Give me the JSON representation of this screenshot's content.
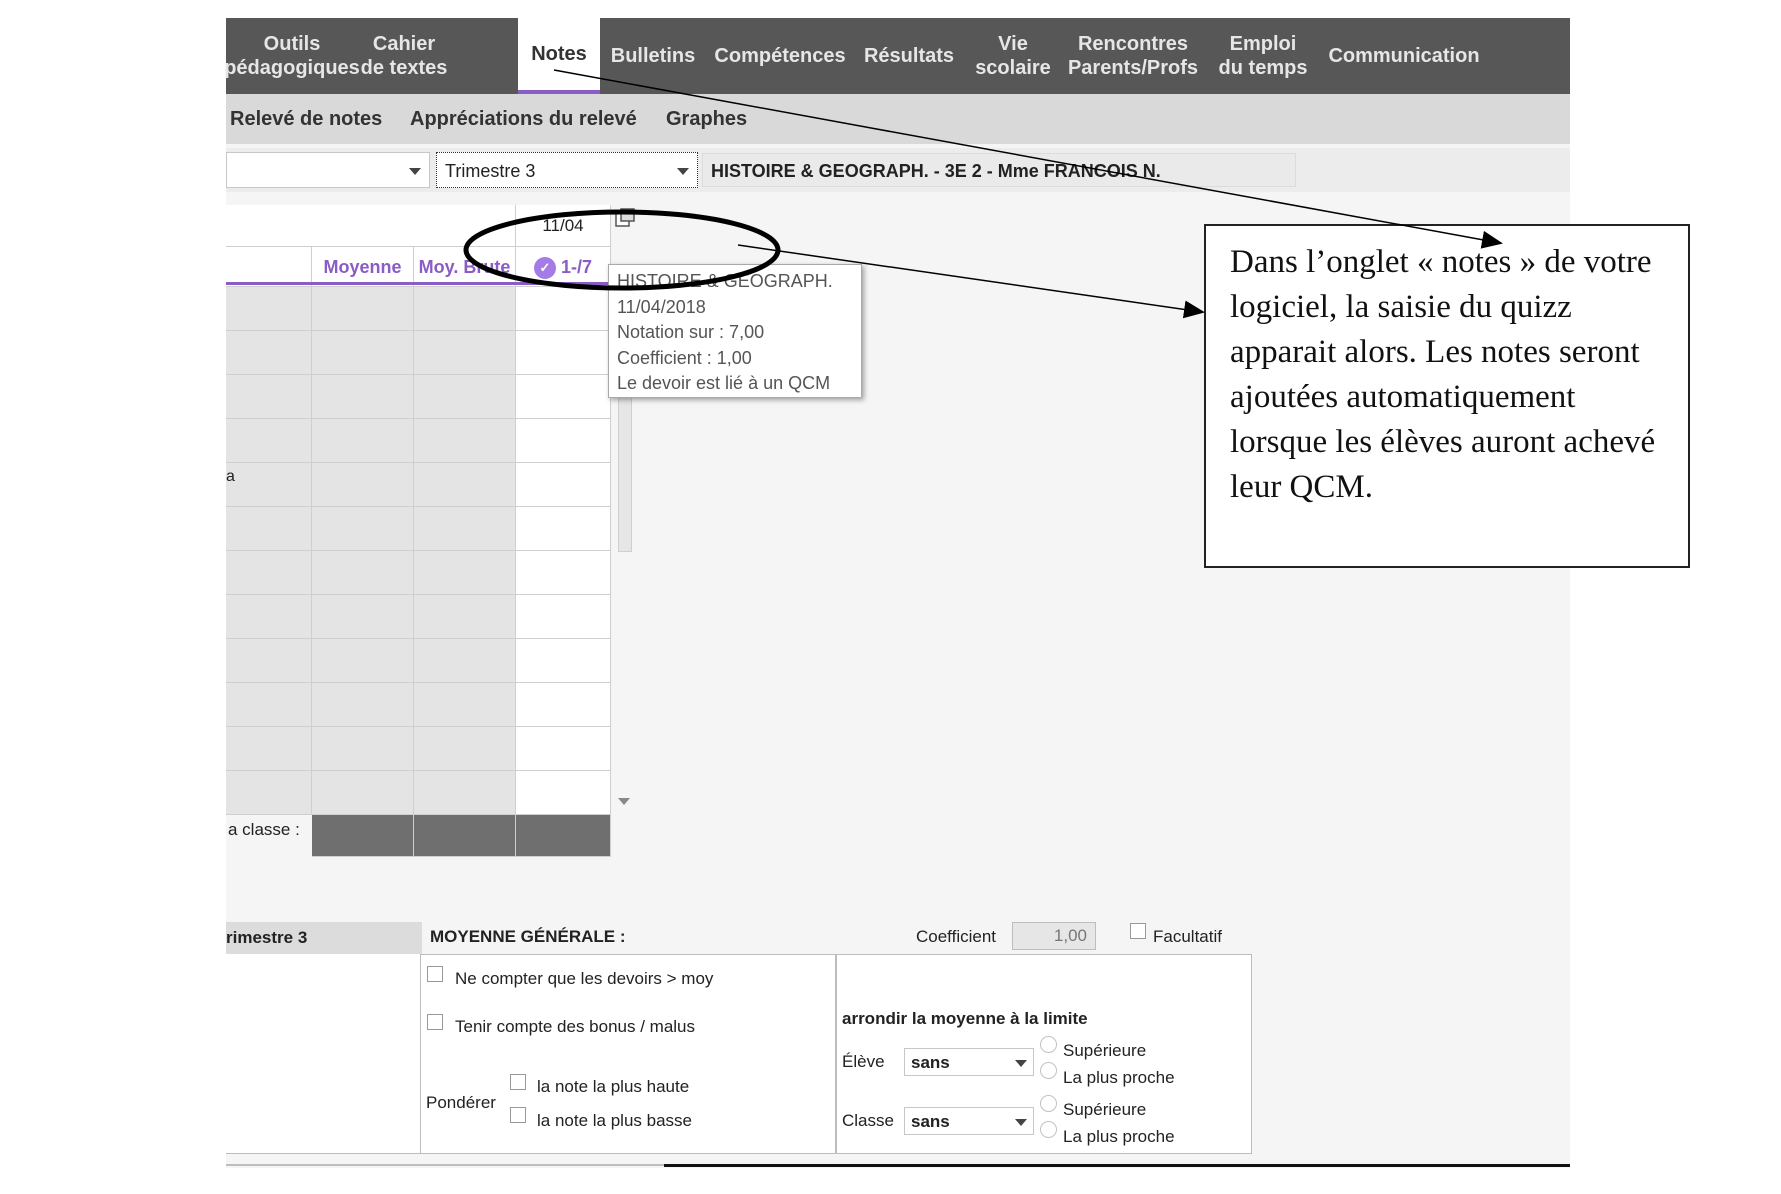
{
  "nav": {
    "tabs": [
      {
        "label": "Outils\npédagogiques"
      },
      {
        "label": "Cahier\nde textes"
      },
      {
        "label": "Notes"
      },
      {
        "label": "Bulletins"
      },
      {
        "label": "Compétences"
      },
      {
        "label": "Résultats"
      },
      {
        "label": "Vie\nscolaire"
      },
      {
        "label": "Rencontres\nParents/Profs"
      },
      {
        "label": "Emploi\ndu temps"
      },
      {
        "label": "Communication"
      }
    ],
    "active_tab": "Notes"
  },
  "subnav": {
    "items": [
      "Relevé de notes",
      "Appréciations du relevé",
      "Graphes"
    ]
  },
  "toolbar": {
    "class_select_value": "",
    "period_select_value": "Trimestre 3",
    "class_info": "HISTOIRE & GEOGRAPH. - 3E 2 - Mme FRANCOIS N."
  },
  "grid": {
    "date_header": "11/04",
    "columns": [
      "Moyenne",
      "Moy. Brute",
      "1-/7"
    ],
    "row_fragment": "a",
    "footer_label": "a classe :",
    "rows": 12
  },
  "tooltip": {
    "lines": [
      "HISTOIRE & GEOGRAPH.",
      "11/04/2018",
      "Notation sur : 7,00",
      "Coefficient : 1,00",
      "Le devoir est lié à un QCM"
    ]
  },
  "bottom": {
    "period_label": "rimestre 3",
    "moyenne_generale": "MOYENNE GÉNÉRALE :",
    "coefficient_label": "Coefficient",
    "coefficient_value": "1,00",
    "facultatif_label": "Facultatif",
    "option_1": "Ne compter que les devoirs > moy",
    "option_2": "Tenir compte des bonus / malus",
    "ponderer_label": "Pondérer",
    "ponderer_opt_1": "la note la plus haute",
    "ponderer_opt_2": "la note la plus basse",
    "arrondir_label": "arrondir la moyenne à la limite",
    "eleve_label": "Élève",
    "classe_label": "Classe",
    "eleve_value": "sans",
    "classe_value": "sans",
    "radio_sup": "Supérieure",
    "radio_proche": "La plus proche"
  },
  "callout": {
    "text": "Dans l’onglet « notes » de votre logiciel, la saisie du quizz apparait alors. Les notes seront ajoutées automatiquement lorsque les élèves auront achevé leur QCM."
  },
  "colors": {
    "accent": "#8a5cc6",
    "nav_bg": "#575757",
    "subnav_bg": "#d9d9d9"
  }
}
